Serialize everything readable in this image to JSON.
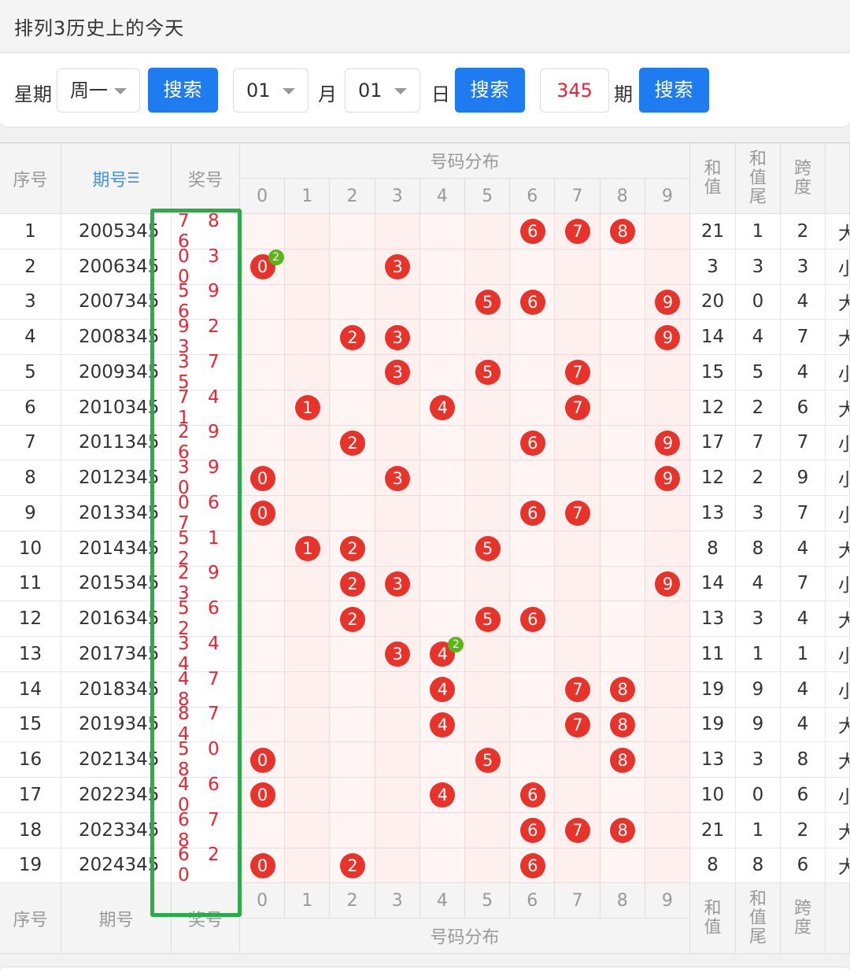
{
  "title": "排列3历史上的今天",
  "filter": {
    "week_label": "星期",
    "week_value": "周一",
    "search_label": "搜索",
    "month_value": "01",
    "month_label": "月",
    "day_value": "01",
    "day_label": "日",
    "period_value": "345",
    "period_label": "期"
  },
  "headers": {
    "index": "序号",
    "issue": "期号",
    "winning": "奖号",
    "distribution": "号码分布",
    "digits": [
      "0",
      "1",
      "2",
      "3",
      "4",
      "5",
      "6",
      "7",
      "8",
      "9"
    ],
    "sum": "和值",
    "sum_tail": "和值尾",
    "span": "跨度",
    "sort_icon": "sort-icon"
  },
  "rows": [
    {
      "index": "1",
      "issue": "2005345",
      "numbers": "786",
      "sum": "21",
      "tail": "1",
      "span": "2",
      "size": "大"
    },
    {
      "index": "2",
      "issue": "2006345",
      "numbers": "030",
      "sum": "3",
      "tail": "3",
      "span": "3",
      "size": "小"
    },
    {
      "index": "3",
      "issue": "2007345",
      "numbers": "596",
      "sum": "20",
      "tail": "0",
      "span": "4",
      "size": "大"
    },
    {
      "index": "4",
      "issue": "2008345",
      "numbers": "923",
      "sum": "14",
      "tail": "4",
      "span": "7",
      "size": "大"
    },
    {
      "index": "5",
      "issue": "2009345",
      "numbers": "375",
      "sum": "15",
      "tail": "5",
      "span": "4",
      "size": "小"
    },
    {
      "index": "6",
      "issue": "2010345",
      "numbers": "741",
      "sum": "12",
      "tail": "2",
      "span": "6",
      "size": "大"
    },
    {
      "index": "7",
      "issue": "2011345",
      "numbers": "296",
      "sum": "17",
      "tail": "7",
      "span": "7",
      "size": "小"
    },
    {
      "index": "8",
      "issue": "2012345",
      "numbers": "390",
      "sum": "12",
      "tail": "2",
      "span": "9",
      "size": "小"
    },
    {
      "index": "9",
      "issue": "2013345",
      "numbers": "067",
      "sum": "13",
      "tail": "3",
      "span": "7",
      "size": "小"
    },
    {
      "index": "10",
      "issue": "2014345",
      "numbers": "512",
      "sum": "8",
      "tail": "8",
      "span": "4",
      "size": "大"
    },
    {
      "index": "11",
      "issue": "2015345",
      "numbers": "293",
      "sum": "14",
      "tail": "4",
      "span": "7",
      "size": "小"
    },
    {
      "index": "12",
      "issue": "2016345",
      "numbers": "562",
      "sum": "13",
      "tail": "3",
      "span": "4",
      "size": "大"
    },
    {
      "index": "13",
      "issue": "2017345",
      "numbers": "344",
      "sum": "11",
      "tail": "1",
      "span": "1",
      "size": "小"
    },
    {
      "index": "14",
      "issue": "2018345",
      "numbers": "478",
      "sum": "19",
      "tail": "9",
      "span": "4",
      "size": "小"
    },
    {
      "index": "15",
      "issue": "2019345",
      "numbers": "874",
      "sum": "19",
      "tail": "9",
      "span": "4",
      "size": "大"
    },
    {
      "index": "16",
      "issue": "2021345",
      "numbers": "508",
      "sum": "13",
      "tail": "3",
      "span": "8",
      "size": "大"
    },
    {
      "index": "17",
      "issue": "2022345",
      "numbers": "460",
      "sum": "10",
      "tail": "0",
      "span": "6",
      "size": "小"
    },
    {
      "index": "18",
      "issue": "2023345",
      "numbers": "678",
      "sum": "21",
      "tail": "1",
      "span": "2",
      "size": "大"
    },
    {
      "index": "19",
      "issue": "2024345",
      "numbers": "620",
      "sum": "8",
      "tail": "8",
      "span": "6",
      "size": "大"
    }
  ],
  "colors": {
    "ball": "#e8332a",
    "badge": "#5ab516",
    "button": "#1e7bf0",
    "highlight_box": "#2bab4a"
  }
}
